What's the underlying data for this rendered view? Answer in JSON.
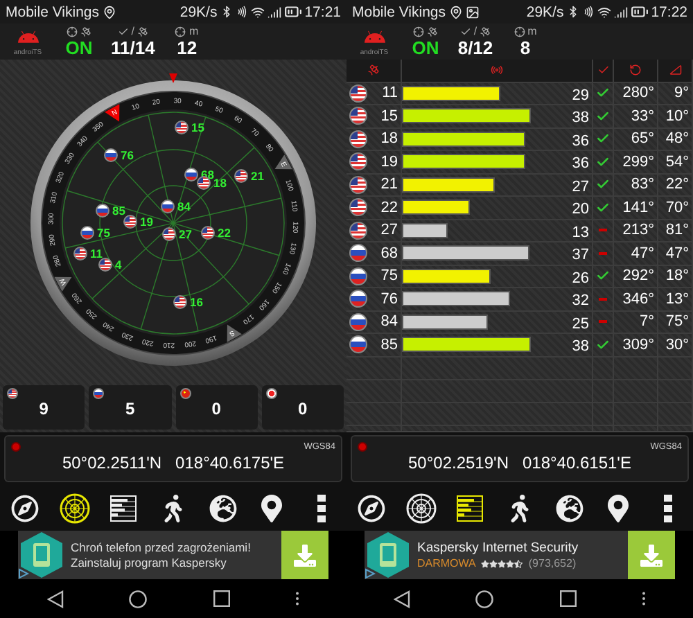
{
  "screens": [
    {
      "status_bar": {
        "carrier": "Mobile Vikings",
        "icons": [
          {
            "kind": "location"
          }
        ],
        "speed": "29K/s",
        "time": "17:21"
      },
      "header": {
        "logo": "androiTS",
        "status": "ON",
        "separator": "/",
        "satellites": "11/14",
        "accuracy": "12",
        "unit": "m"
      },
      "kind": "radar",
      "radar": {
        "cardinals": [
          "N",
          "E",
          "S",
          "W"
        ],
        "dial": [
          "10",
          "20",
          "30",
          "40",
          "50",
          "60",
          "70",
          "80",
          "100",
          "110",
          "120",
          "130",
          "140",
          "150",
          "160",
          "170",
          "190",
          "200",
          "210",
          "220",
          "230",
          "240",
          "250",
          "260",
          "280",
          "290",
          "300",
          "310",
          "320",
          "330",
          "340",
          "350"
        ],
        "satellites": [
          {
            "kind": "us",
            "prn": "15"
          },
          {
            "kind": "ru",
            "prn": "76"
          },
          {
            "kind": "ru",
            "prn": "68"
          },
          {
            "kind": "us",
            "prn": "18"
          },
          {
            "kind": "us",
            "prn": "21"
          },
          {
            "kind": "ru",
            "prn": "84"
          },
          {
            "kind": "ru",
            "prn": "85"
          },
          {
            "kind": "us",
            "prn": "19"
          },
          {
            "kind": "ru",
            "prn": "75"
          },
          {
            "kind": "us",
            "prn": "27"
          },
          {
            "kind": "us",
            "prn": "22"
          },
          {
            "kind": "us",
            "prn": "11"
          },
          {
            "kind": "us",
            "prn": "4"
          },
          {
            "kind": "us",
            "prn": "16"
          }
        ]
      },
      "counts": [
        {
          "kind": "us",
          "count": "9"
        },
        {
          "kind": "ru",
          "count": "5"
        },
        {
          "kind": "cn",
          "count": "0"
        },
        {
          "kind": "jp",
          "count": "0"
        }
      ],
      "position": {
        "datum": "WGS84",
        "lat": "50°02.2511'N",
        "lon": "018°40.6175'E"
      },
      "toolbar": [
        {
          "kind": "compass",
          "selected": false
        },
        {
          "kind": "radar",
          "selected": true
        },
        {
          "kind": "table",
          "selected": false
        },
        {
          "kind": "walker",
          "selected": false
        },
        {
          "kind": "globe",
          "selected": false
        },
        {
          "kind": "pin",
          "selected": false
        },
        {
          "kind": "more",
          "selected": false
        }
      ],
      "ad": {
        "kind": "text",
        "lines": [
          "Chroń telefon przed zagrożeniami!",
          "Zainstaluj program Kaspersky"
        ]
      }
    },
    {
      "status_bar": {
        "carrier": "Mobile Vikings",
        "icons": [
          {
            "kind": "location"
          },
          {
            "kind": "image"
          }
        ],
        "speed": "29K/s",
        "time": "17:22"
      },
      "header": {
        "logo": "androiTS",
        "status": "ON",
        "separator": "/",
        "satellites": "8/12",
        "accuracy": "8",
        "unit": "m"
      },
      "kind": "table",
      "table": {
        "rows": [
          {
            "kind": "us",
            "prn": "11",
            "level": 0.52,
            "color": "#f2f200",
            "snr": "29",
            "used": true,
            "azimuth": "280°",
            "elevation": "9°"
          },
          {
            "kind": "us",
            "prn": "15",
            "level": 0.68,
            "color": "#c6f000",
            "snr": "38",
            "used": true,
            "azimuth": "33°",
            "elevation": "10°"
          },
          {
            "kind": "us",
            "prn": "18",
            "level": 0.65,
            "color": "#c6f000",
            "snr": "36",
            "used": true,
            "azimuth": "65°",
            "elevation": "48°"
          },
          {
            "kind": "us",
            "prn": "19",
            "level": 0.65,
            "color": "#c6f000",
            "snr": "36",
            "used": true,
            "azimuth": "299°",
            "elevation": "54°"
          },
          {
            "kind": "us",
            "prn": "21",
            "level": 0.49,
            "color": "#f2f200",
            "snr": "27",
            "used": true,
            "azimuth": "83°",
            "elevation": "22°"
          },
          {
            "kind": "us",
            "prn": "22",
            "level": 0.36,
            "color": "#f2f200",
            "snr": "20",
            "used": true,
            "azimuth": "141°",
            "elevation": "70°"
          },
          {
            "kind": "us",
            "prn": "27",
            "level": 0.24,
            "color": "#cccccc",
            "snr": "13",
            "used": false,
            "azimuth": "213°",
            "elevation": "81°"
          },
          {
            "kind": "ru",
            "prn": "68",
            "level": 0.67,
            "color": "#cccccc",
            "snr": "37",
            "used": false,
            "azimuth": "47°",
            "elevation": "47°"
          },
          {
            "kind": "ru",
            "prn": "75",
            "level": 0.47,
            "color": "#f2f200",
            "snr": "26",
            "used": true,
            "azimuth": "292°",
            "elevation": "18°"
          },
          {
            "kind": "ru",
            "prn": "76",
            "level": 0.57,
            "color": "#cccccc",
            "snr": "32",
            "used": false,
            "azimuth": "346°",
            "elevation": "13°"
          },
          {
            "kind": "ru",
            "prn": "84",
            "level": 0.45,
            "color": "#cccccc",
            "snr": "25",
            "used": false,
            "azimuth": "7°",
            "elevation": "75°"
          },
          {
            "kind": "ru",
            "prn": "85",
            "level": 0.68,
            "color": "#c6f000",
            "snr": "38",
            "used": true,
            "azimuth": "309°",
            "elevation": "30°"
          }
        ]
      },
      "position": {
        "datum": "WGS84",
        "lat": "50°02.2519'N",
        "lon": "018°40.6151'E"
      },
      "toolbar": [
        {
          "kind": "compass",
          "selected": false
        },
        {
          "kind": "radar",
          "selected": false
        },
        {
          "kind": "table",
          "selected": true
        },
        {
          "kind": "walker",
          "selected": false
        },
        {
          "kind": "globe",
          "selected": false
        },
        {
          "kind": "pin",
          "selected": false
        },
        {
          "kind": "more",
          "selected": false
        }
      ],
      "ad": {
        "kind": "app",
        "title": "Kaspersky Internet Security",
        "price": "DARMOWA",
        "stars": 4.5,
        "reviews": "(973,652)"
      }
    }
  ]
}
